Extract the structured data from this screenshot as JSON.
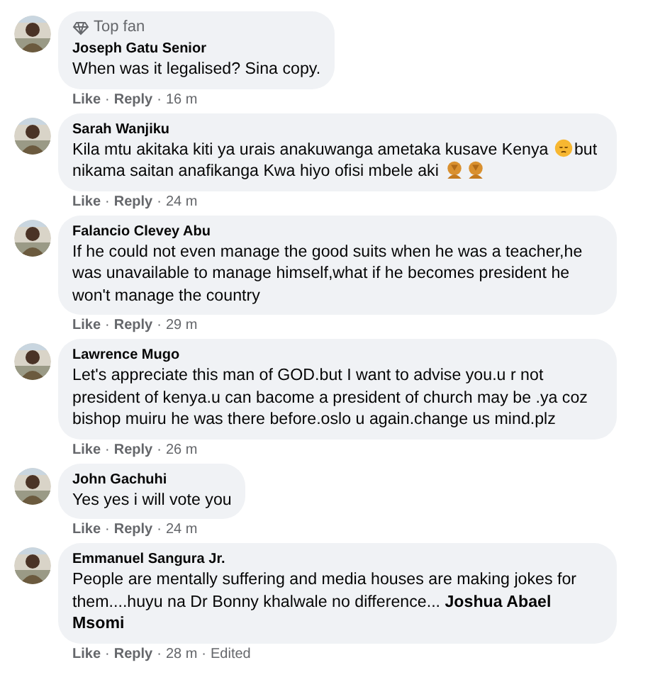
{
  "separator": "·",
  "comments": [
    {
      "badge": "Top fan",
      "author": "Joseph Gatu Senior",
      "body": [
        {
          "kind": "text",
          "text": "When was it legalised? Sina copy."
        }
      ],
      "actions": [
        "Like",
        "Reply"
      ],
      "time": "16 m",
      "avatar": {
        "kind": "picture"
      }
    },
    {
      "author": "Sarah Wanjiku",
      "body": [
        {
          "kind": "text",
          "text": "Kila mtu akitaka kiti ya urais anakuwanga ametaka kusave Kenya "
        },
        {
          "kind": "emoji"
        },
        {
          "kind": "text",
          "text": "but nikama saitan anafikanga Kwa hiyo ofisi mbele aki "
        },
        {
          "kind": "facepalm"
        },
        {
          "kind": "facepalm"
        }
      ],
      "actions": [
        "Like",
        "Reply"
      ],
      "time": "24 m",
      "avatar": {
        "kind": "picture"
      }
    },
    {
      "author": "Falancio Clevey Abu",
      "body": [
        {
          "kind": "text",
          "text": "If he could not even manage the good suits when he was a teacher,he was unavailable to manage himself,what if he becomes president he won't manage the country"
        }
      ],
      "actions": [
        "Like",
        "Reply"
      ],
      "time": "29 m",
      "avatar": {
        "kind": "picture"
      }
    },
    {
      "author": "Lawrence Mugo",
      "body": [
        {
          "kind": "text",
          "text": "Let's appreciate this man of GOD.but I want to advise you.u r not president of kenya.u can bacome a president of church may be .ya coz bishop muiru he was there before.oslo u again.change us mind.plz"
        }
      ],
      "actions": [
        "Like",
        "Reply"
      ],
      "time": "26 m",
      "avatar": {
        "kind": "picture"
      }
    },
    {
      "author": "John Gachuhi",
      "body": [
        {
          "kind": "text",
          "text": "Yes yes i will vote you"
        }
      ],
      "actions": [
        "Like",
        "Reply"
      ],
      "time": "24 m",
      "avatar": {
        "kind": "picture"
      }
    },
    {
      "author": "Emmanuel Sangura Jr.",
      "body": [
        {
          "kind": "text",
          "text": "People are mentally suffering and media houses are making jokes for them....huyu na Dr Bonny khalwale no difference... **Joshua Abael Msomi**"
        }
      ],
      "actions": [
        "Like",
        "Reply"
      ],
      "time": "28 m",
      "note": "Edited",
      "avatar": {
        "kind": "picture"
      }
    }
  ]
}
